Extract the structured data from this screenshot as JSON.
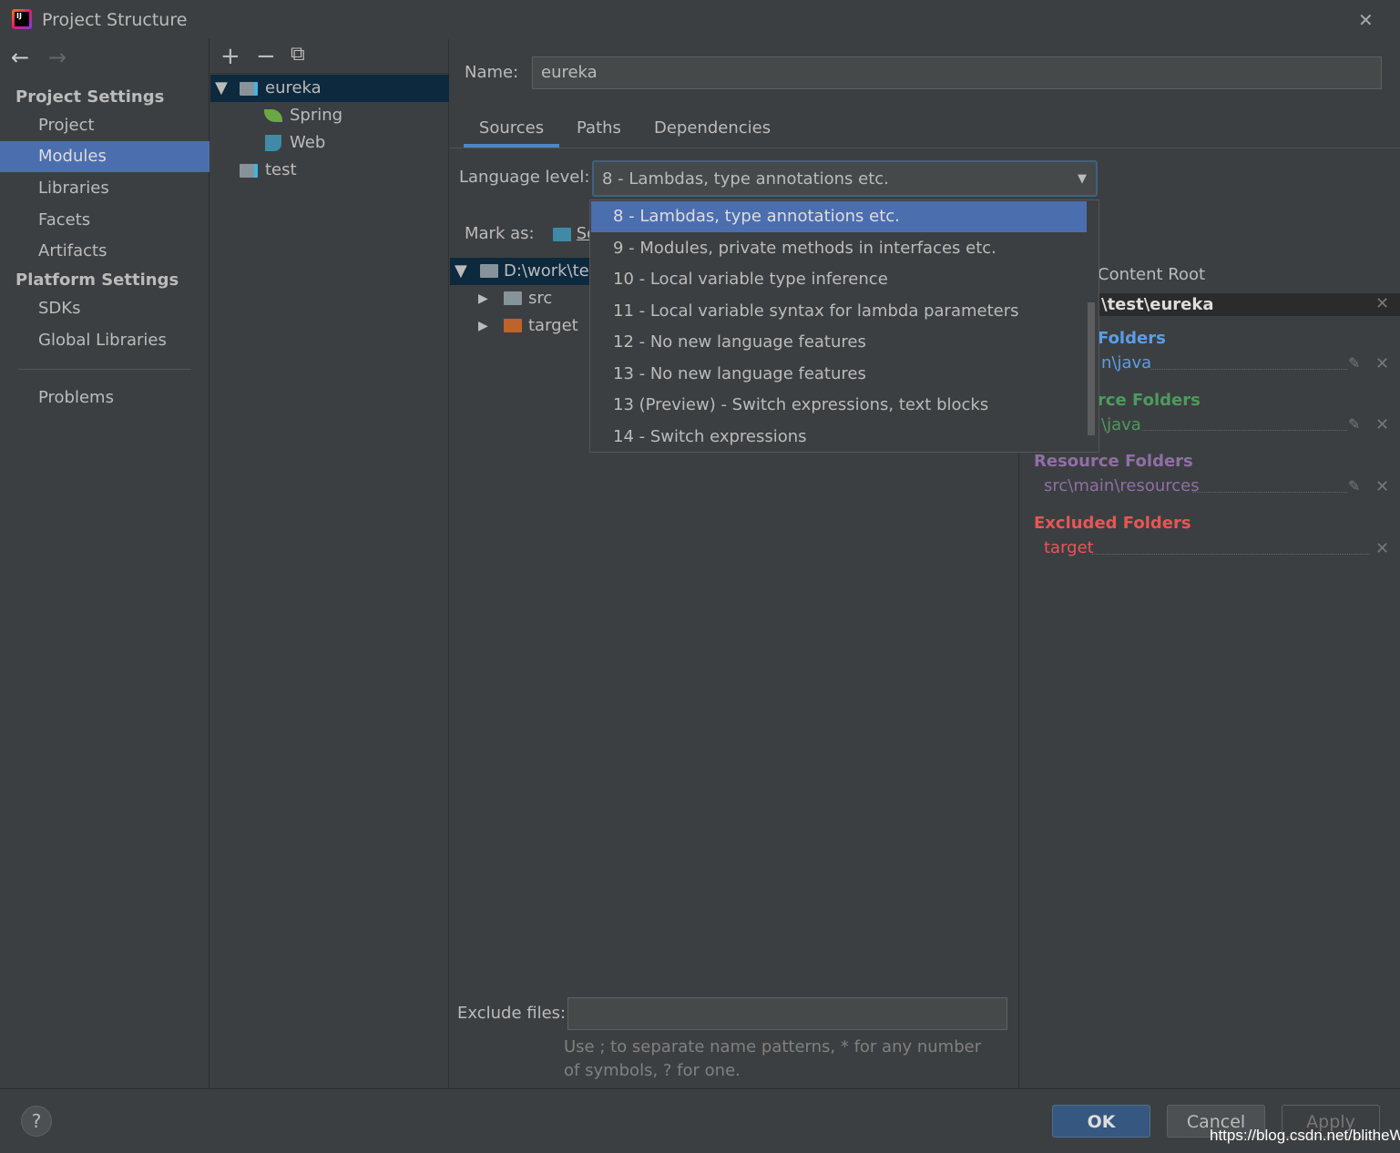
{
  "window": {
    "title": "Project Structure",
    "close": "✕"
  },
  "nav": {
    "back": "←",
    "forward": "→"
  },
  "sidebar": {
    "project_settings": "Project Settings",
    "platform_settings": "Platform Settings",
    "items": [
      "Project",
      "Modules",
      "Libraries",
      "Facets",
      "Artifacts"
    ],
    "platform_items": [
      "SDKs",
      "Global Libraries"
    ],
    "problems": "Problems"
  },
  "tree": {
    "toolbar": {
      "add": "+",
      "remove": "−",
      "copy": "⧉"
    },
    "nodes": [
      {
        "label": "eureka",
        "icon": "module-folder-icon",
        "expanded": true,
        "selected": true
      },
      {
        "label": "Spring",
        "icon": "spring-leaf-icon"
      },
      {
        "label": "Web",
        "icon": "web-icon"
      },
      {
        "label": "test",
        "icon": "module-folder-icon"
      }
    ]
  },
  "module": {
    "name_label": "Name:",
    "name_value": "eureka",
    "tabs": [
      "Sources",
      "Paths",
      "Dependencies"
    ],
    "active_tab": "Sources",
    "language_label": "Language level:",
    "language_value": "8 - Lambdas, type annotations etc.",
    "language_options": [
      "8 - Lambdas, type annotations etc.",
      "9 - Modules, private methods in interfaces etc.",
      "10 - Local variable type inference",
      "11 - Local variable syntax for lambda parameters",
      "12 - No new language features",
      "13 - No new language features",
      "13 (Preview) - Switch expressions, text blocks",
      "14 - Switch expressions"
    ],
    "mark_as_label": "Mark as:",
    "mark_sources": "Sources",
    "file_tree": [
      {
        "label": "D:\\work\\test\\eureka",
        "expanded": true
      },
      {
        "label": "src"
      },
      {
        "label": "target"
      }
    ],
    "exclude_label": "Exclude files:",
    "exclude_value": "",
    "exclude_hint": "Use ; to separate name patterns, * for any number of symbols, ? for one."
  },
  "content_root": {
    "add_label": "Content Root",
    "root_path": "\\test\\eureka",
    "sources_title": "Folders",
    "sources_path": "n\\java",
    "test_title": "rce Folders",
    "test_path": "\\java",
    "resource_title": "Resource Folders",
    "resource_path": "src\\main\\resources",
    "excluded_title": "Excluded Folders",
    "excluded_path": "target"
  },
  "colors": {
    "selection": "#4b6eaf",
    "sources": "#5a9ee8",
    "test": "#4e9a5f",
    "resources": "#8f6fa5",
    "excluded": "#e85555",
    "ok": "#365880"
  },
  "buttons": {
    "help": "?",
    "ok": "OK",
    "cancel": "Cancel",
    "apply": "Apply"
  },
  "watermark": "https://blog.csdn.net/blitheW"
}
